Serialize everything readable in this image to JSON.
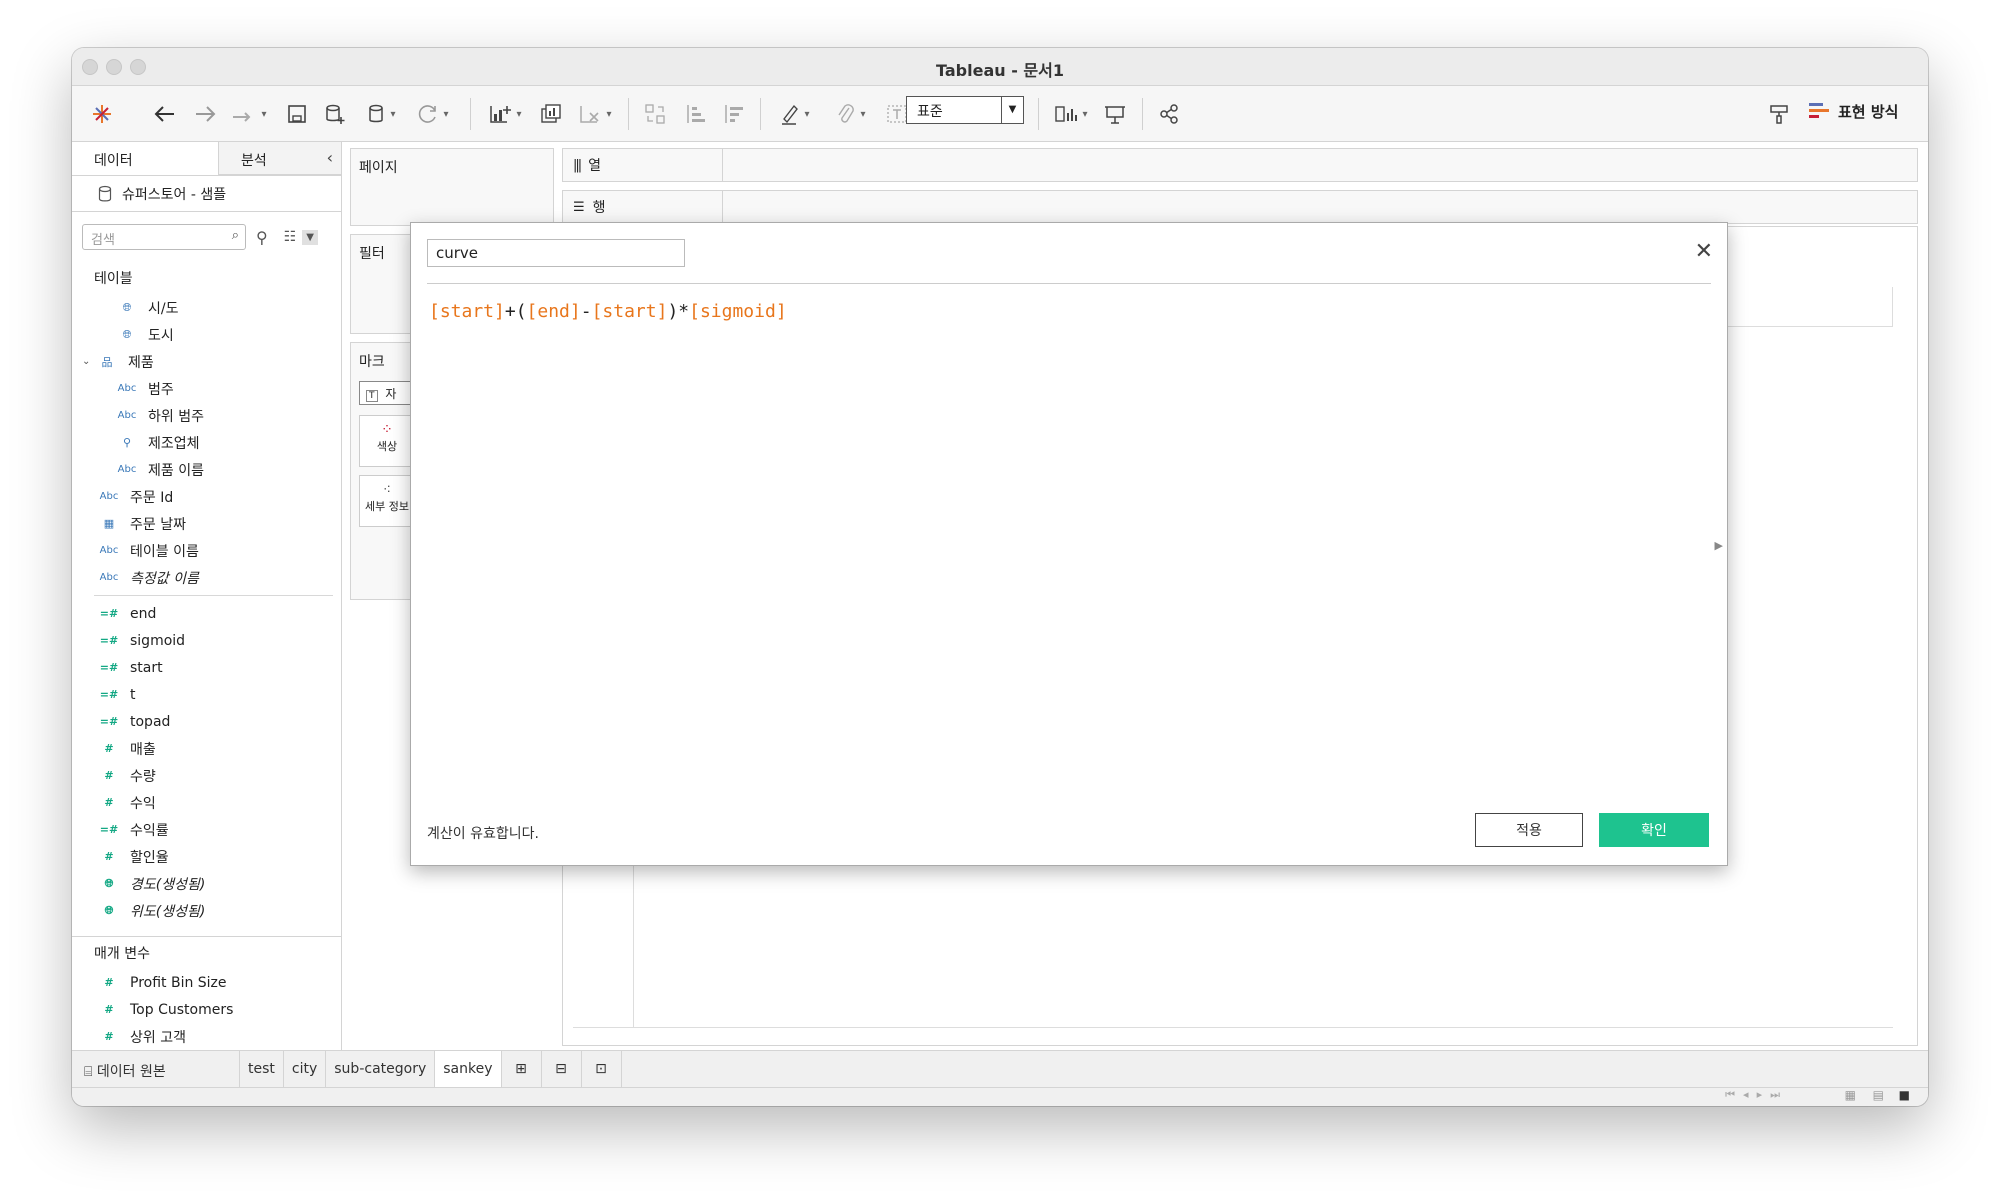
{
  "window": {
    "title": "Tableau - 문서1"
  },
  "toolbar": {
    "standard_select": "표준",
    "show_me": "표현 방식"
  },
  "sidebar": {
    "tab_data": "데이터",
    "tab_analysis": "분석",
    "datasource": "슈퍼스토어 - 샘플",
    "search_placeholder": "검색",
    "tables_header": "테이블",
    "fields": [
      {
        "icon": "globe",
        "name": "시/도",
        "level": 1
      },
      {
        "icon": "globe",
        "name": "도시",
        "level": 1
      },
      {
        "icon": "hierarchy",
        "name": "제품",
        "level": 0
      },
      {
        "icon": "Abc",
        "name": "범주",
        "level": 1
      },
      {
        "icon": "Abc",
        "name": "하위 범주",
        "level": 1
      },
      {
        "icon": "clip",
        "name": "제조업체",
        "level": 1
      },
      {
        "icon": "Abc",
        "name": "제품 이름",
        "level": 1
      },
      {
        "icon": "Abc",
        "name": "주문 Id",
        "level": 0
      },
      {
        "icon": "calendar",
        "name": "주문 날짜",
        "level": 0
      },
      {
        "icon": "Abc",
        "name": "테이블 이름",
        "level": 0
      },
      {
        "icon": "Abc",
        "name": "측정값 이름",
        "level": 0
      }
    ],
    "measures": [
      {
        "icon": "=#",
        "name": "end"
      },
      {
        "icon": "=#",
        "name": "sigmoid"
      },
      {
        "icon": "=#",
        "name": "start"
      },
      {
        "icon": "=#",
        "name": "t"
      },
      {
        "icon": "=#",
        "name": "topad"
      },
      {
        "icon": "#",
        "name": "매출"
      },
      {
        "icon": "#",
        "name": "수량"
      },
      {
        "icon": "#",
        "name": "수익"
      },
      {
        "icon": "=#",
        "name": "수익률"
      },
      {
        "icon": "#",
        "name": "할인율"
      },
      {
        "icon": "globe",
        "name": "경도(생성됨)"
      },
      {
        "icon": "globe",
        "name": "위도(생성됨)"
      }
    ],
    "params_header": "매개 변수",
    "params": [
      "Profit Bin Size",
      "Top Customers",
      "상위 고객"
    ]
  },
  "panes": {
    "pages": "페이지",
    "filters": "필터",
    "marks": "마크",
    "marks_type": "자",
    "color": "색상",
    "detail": "세부 정보",
    "columns": "열",
    "rows": "행"
  },
  "dialog": {
    "calc_name": "curve",
    "formula_tokens": [
      {
        "text": "[start]",
        "kind": "field"
      },
      {
        "text": "+(",
        "kind": "op"
      },
      {
        "text": "[end]",
        "kind": "field"
      },
      {
        "text": "-",
        "kind": "op"
      },
      {
        "text": "[start]",
        "kind": "field"
      },
      {
        "text": ")*",
        "kind": "op"
      },
      {
        "text": "[sigmoid]",
        "kind": "field"
      }
    ],
    "valid_message": "계산이 유효합니다.",
    "apply": "적용",
    "ok": "확인"
  },
  "bottom_tabs": {
    "data_source": "데이터 원본",
    "sheets": [
      "test",
      "city",
      "sub-category",
      "sankey"
    ],
    "active_sheet": "sankey"
  },
  "colors": {
    "accent_green": "#1ec38f",
    "field_orange": "#e8761c",
    "measure_green": "#13a884",
    "dimension_blue": "#3a78b8"
  }
}
